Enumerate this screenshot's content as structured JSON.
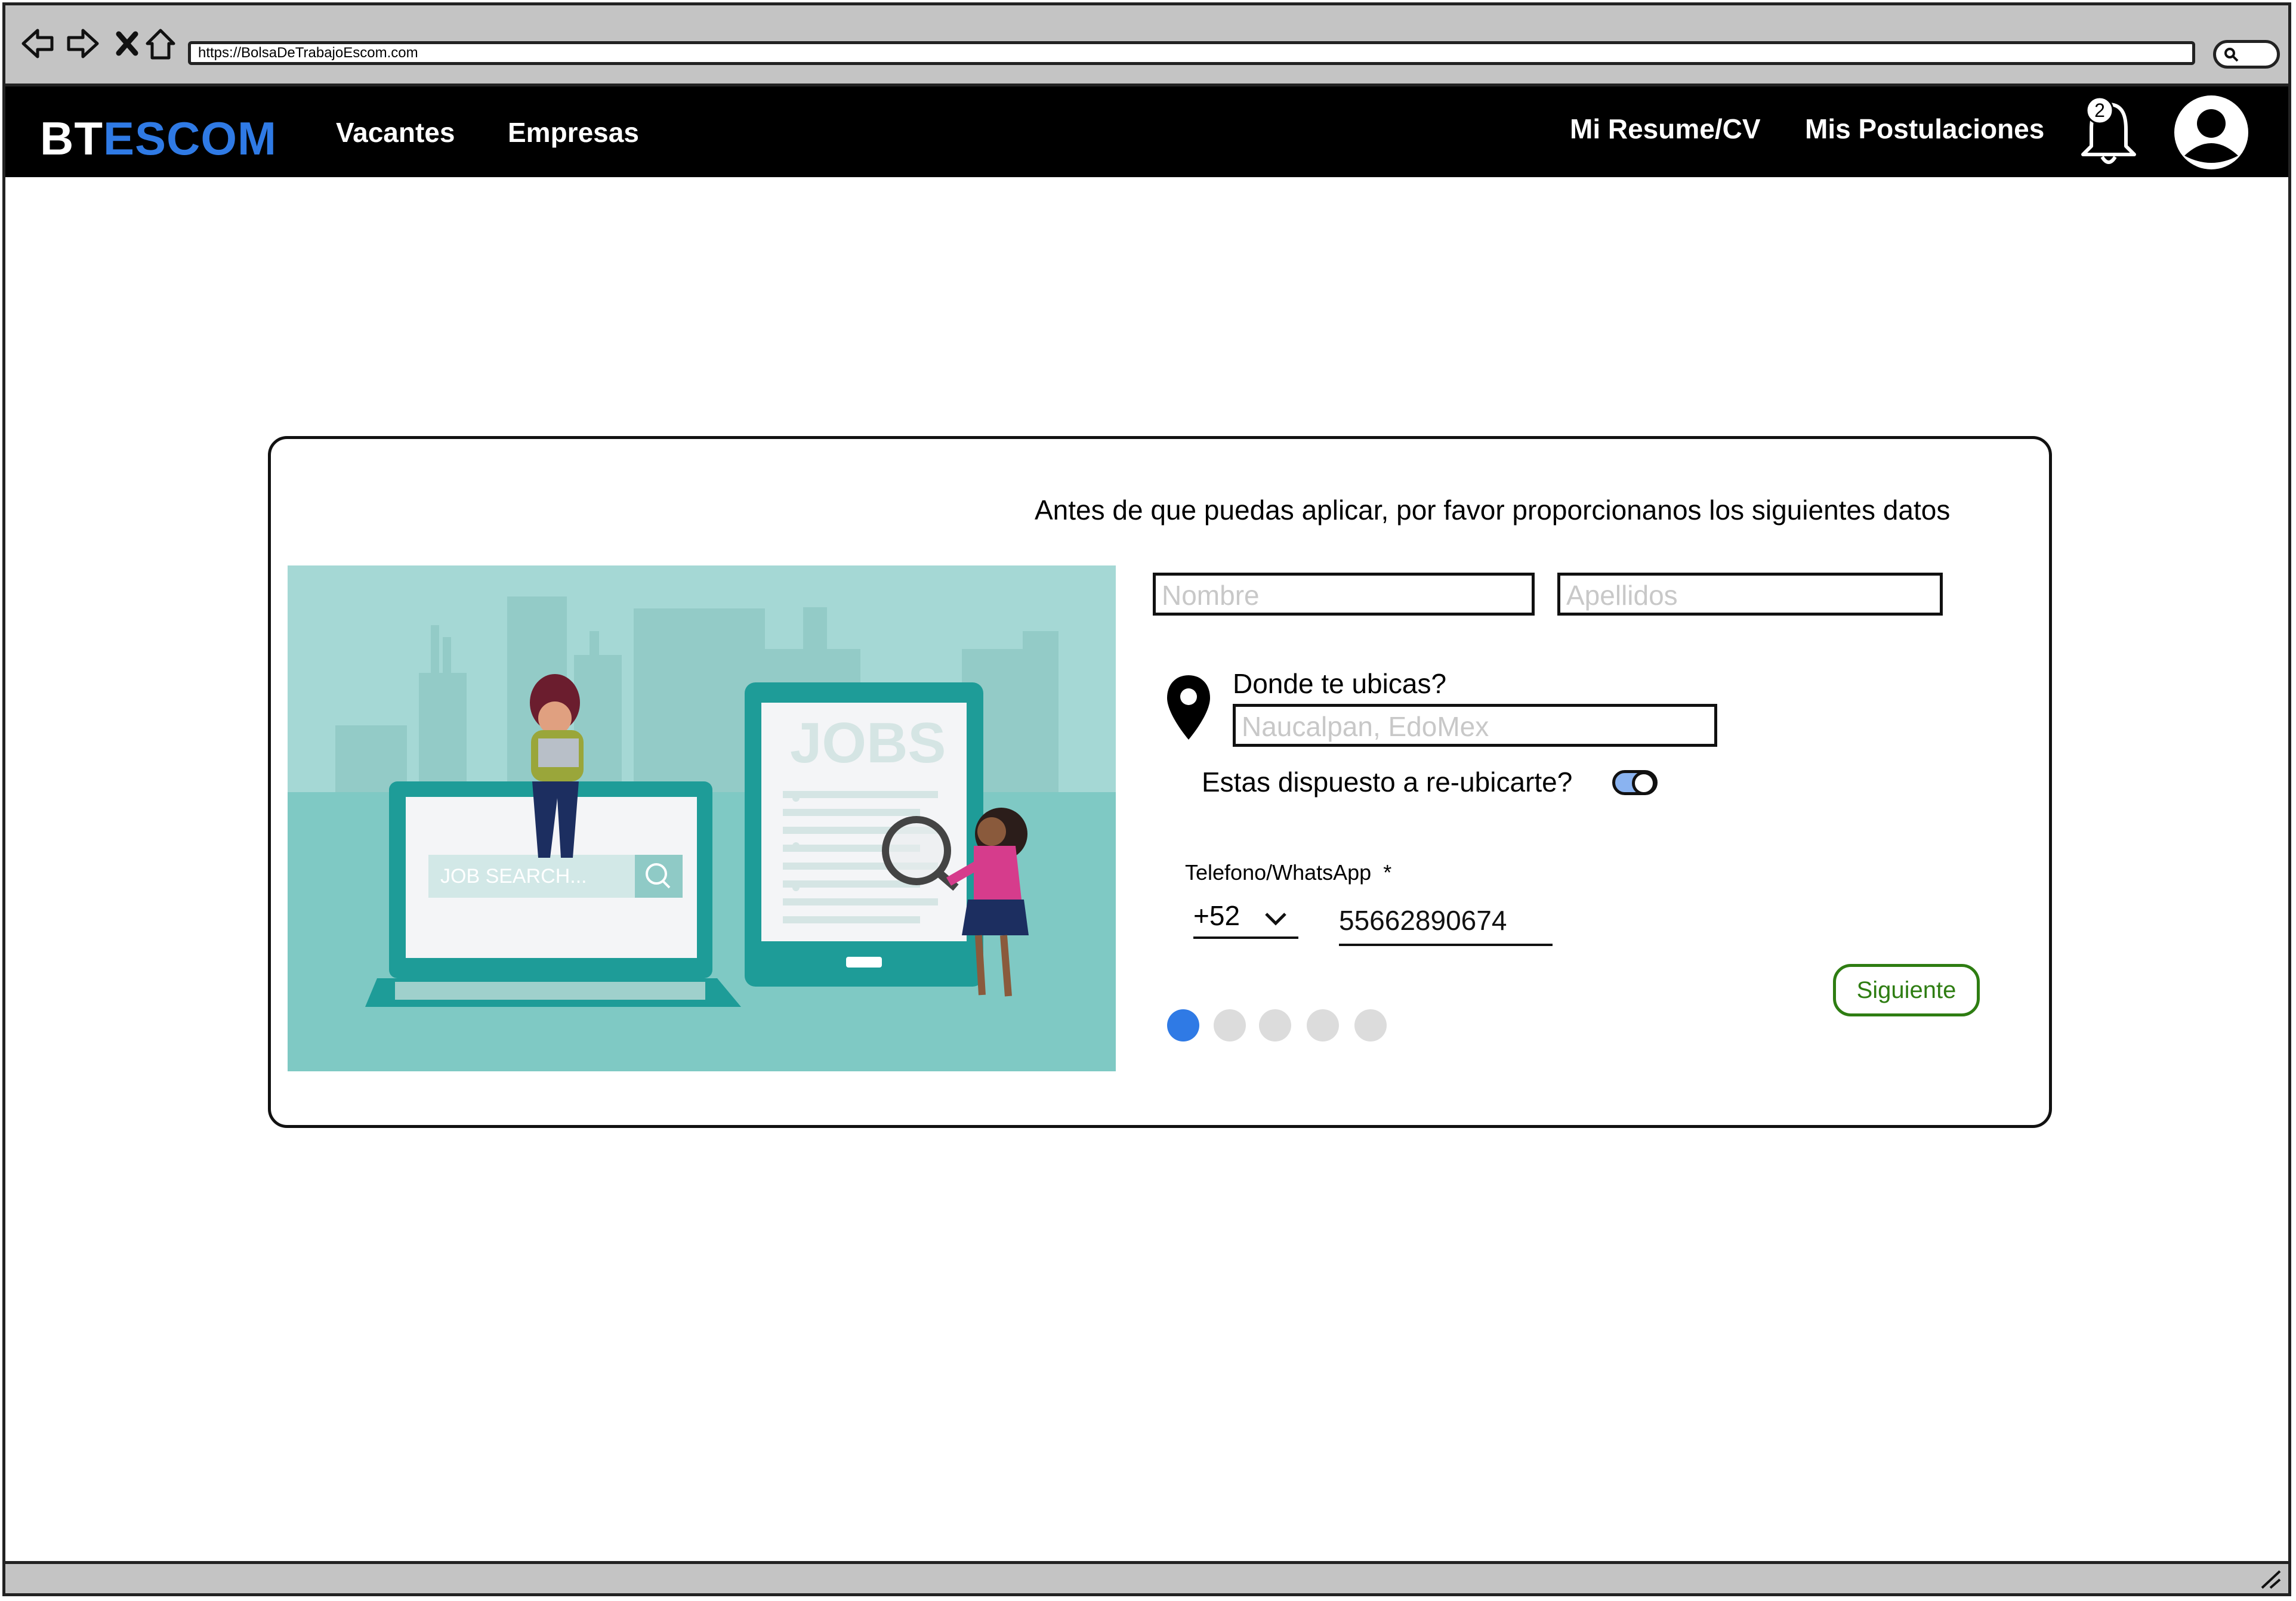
{
  "browser": {
    "url": "https://BolsaDeTrabajoEscom.com",
    "icons": [
      "back-icon",
      "forward-icon",
      "close-icon",
      "home-icon",
      "search-icon"
    ]
  },
  "header": {
    "logo_part1": "BT",
    "logo_part2": "ESCOM",
    "nav": [
      "Vacantes",
      "Empresas"
    ],
    "right_links": [
      "Mi Resume/CV",
      "Mis Postulaciones"
    ],
    "notification_count": "2",
    "colors": {
      "brand_blue": "#2f7ae5",
      "bar": "#000000"
    }
  },
  "form": {
    "heading": "Antes de que puedas aplicar, por favor proporcionanos los siguientes datos",
    "nombre_placeholder": "Nombre",
    "apellidos_placeholder": "Apellidos",
    "location_label": "Donde te ubicas?",
    "location_placeholder": "Naucalpan, EdoMex",
    "relocate_label": "Estas dispuesto a re-ubicarte?",
    "relocate_on": true,
    "phone_label": "Telefono/WhatsApp",
    "phone_required": "*",
    "country_code": "+52",
    "phone_value": "55662890674",
    "next_button": "Siguiente",
    "steps_total": 5,
    "steps_current": 1
  },
  "illustration": {
    "search_text": "JOB SEARCH...",
    "jobs_text": "JOBS"
  }
}
